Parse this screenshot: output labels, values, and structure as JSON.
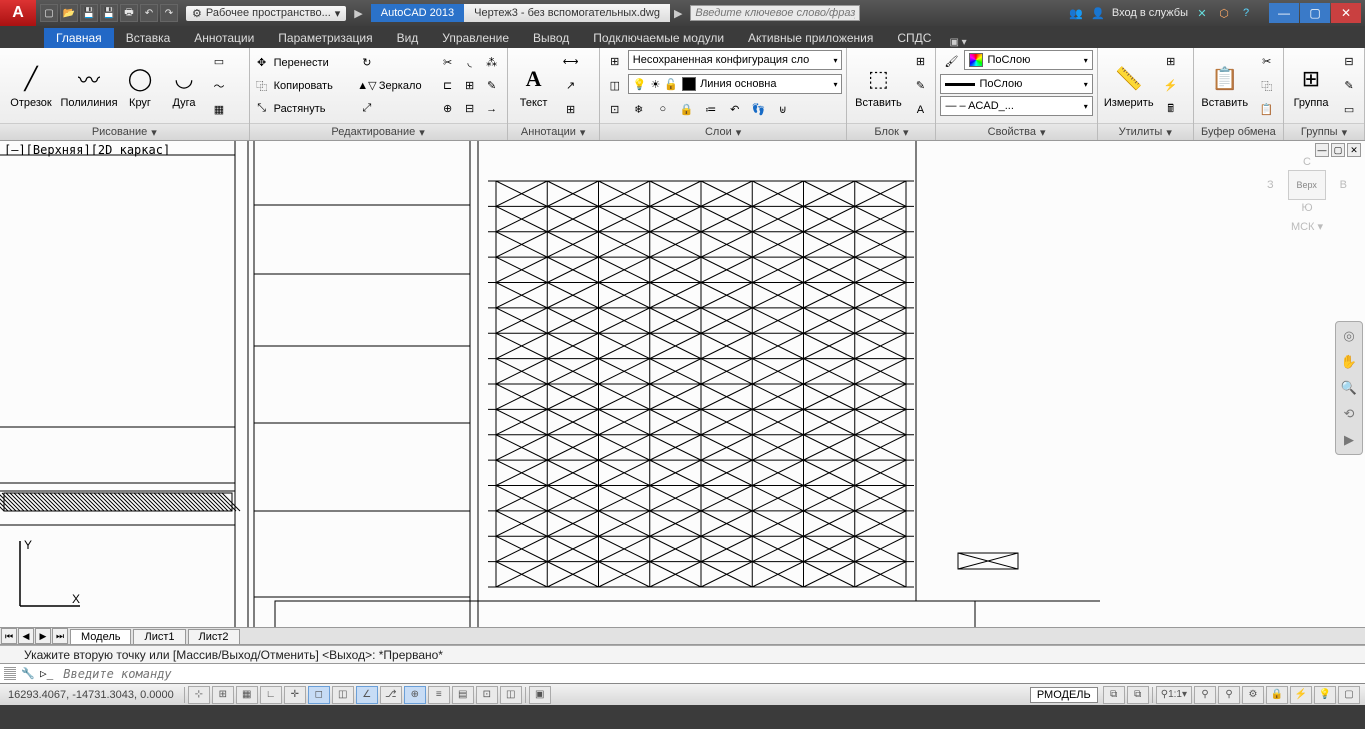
{
  "titlebar": {
    "workspace_label": "Рабочее пространство...",
    "app_name": "AutoCAD 2013",
    "file_name": "Чертеж3 - без вспомогательных.dwg",
    "search_placeholder": "Введите ключевое слово/фразу",
    "login_label": "Вход в службы"
  },
  "tabs": [
    "Главная",
    "Вставка",
    "Аннотации",
    "Параметризация",
    "Вид",
    "Управление",
    "Вывод",
    "Подключаемые модули",
    "Активные приложения",
    "СПДС"
  ],
  "active_tab": "Главная",
  "panels": {
    "draw": {
      "title": "Рисование",
      "items": {
        "line": "Отрезок",
        "polyline": "Полилиния",
        "circle": "Круг",
        "arc": "Дуга"
      }
    },
    "modify": {
      "title": "Редактирование",
      "items": {
        "move": "Перенести",
        "copy": "Копировать",
        "stretch": "Растянуть",
        "mirror": "Зеркало"
      }
    },
    "annotation": {
      "title": "Аннотации",
      "text": "Текст"
    },
    "layers": {
      "title": "Слои",
      "config": "Несохраненная конфигурация сло",
      "current": "Линия основна"
    },
    "block": {
      "title": "Блок",
      "insert": "Вставить"
    },
    "properties": {
      "title": "Свойства",
      "color": "ПоСлою",
      "lineweight": "ПоСлою",
      "linetype": "— – ACAD_..."
    },
    "utilities": {
      "title": "Утилиты",
      "measure": "Измерить"
    },
    "clipboard": {
      "title": "Буфер обмена",
      "paste": "Вставить"
    },
    "groups": {
      "title": "Группы",
      "group": "Группа"
    }
  },
  "viewport": {
    "label": "[–][Верхняя][2D каркас]",
    "viewcube": {
      "top": "Верх",
      "n": "С",
      "s": "Ю",
      "e": "В",
      "w": "З",
      "wcs": "МСК"
    }
  },
  "layout_tabs": [
    "Модель",
    "Лист1",
    "Лист2"
  ],
  "command": {
    "history": "Укажите вторую точку или [Массив/Выход/Отменить] <Выход>: *Прервано*",
    "placeholder": "Введите команду"
  },
  "statusbar": {
    "coords": "16293.4067, -14731.3043, 0.0000",
    "model_badge": "РМОДЕЛЬ",
    "scale": "1:1"
  }
}
